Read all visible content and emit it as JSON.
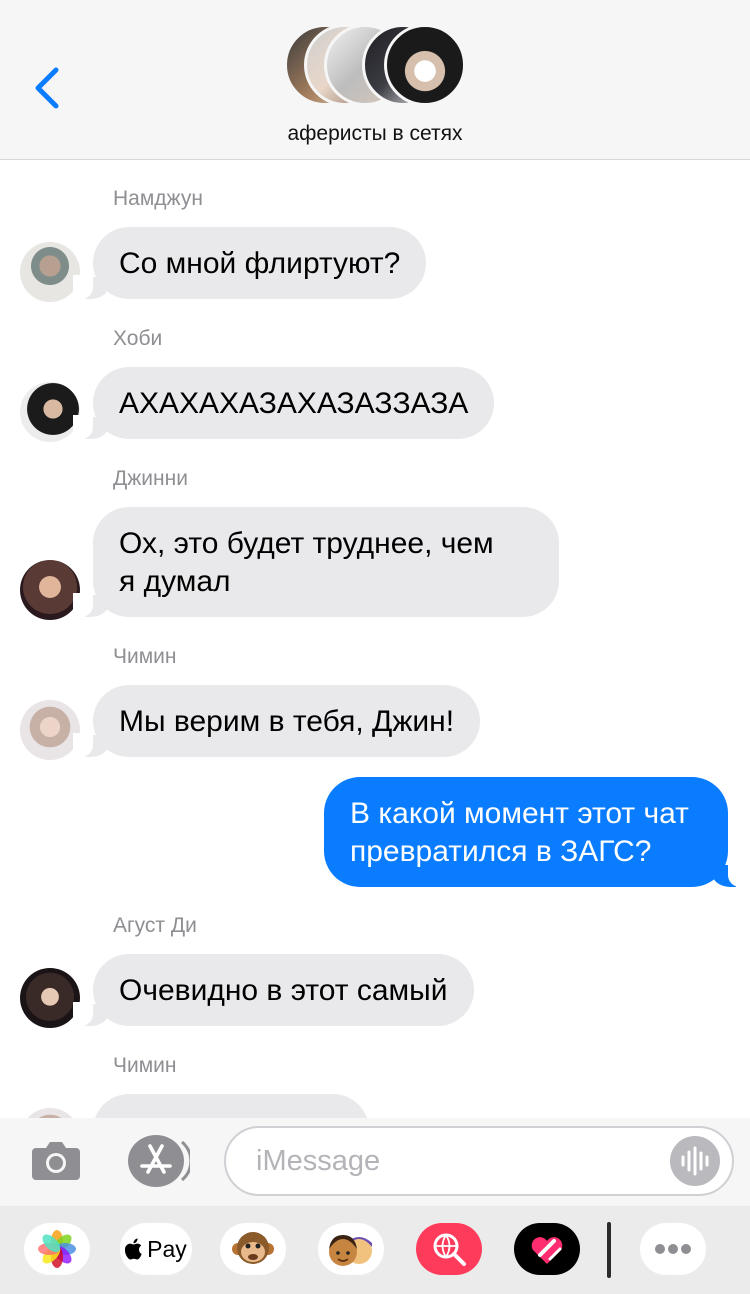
{
  "header": {
    "group_name": "аферисты в сетях",
    "accent": "#0a7cff"
  },
  "messages": [
    {
      "sender": "Намджун",
      "text": "Со мной флиртуют?",
      "direction": "incoming"
    },
    {
      "sender": "Хоби",
      "text": "АХАХАХАЗАХАЗАЗЗАЗА",
      "direction": "incoming"
    },
    {
      "sender": "Джинни",
      "text_line1": "Ох, это будет труднее, чем",
      "text_line2": "я думал",
      "direction": "incoming"
    },
    {
      "sender": "Чимин",
      "text": "Мы верим в тебя, Джин!",
      "direction": "incoming"
    },
    {
      "text_line1": "В какой момент этот чат",
      "text_line2": "превратился в ЗАГС?",
      "direction": "outgoing"
    },
    {
      "sender": "Агуст Ди",
      "text": "Очевидно в этот самый",
      "direction": "incoming"
    },
    {
      "sender": "Чимин",
      "direction": "incoming"
    }
  ],
  "composer": {
    "placeholder": "iMessage"
  },
  "drawer": {
    "apple_pay_label": "Pay",
    "apps": [
      "photos-icon",
      "apple-pay-icon",
      "monkey-animoji-icon",
      "memoji-icon",
      "image-search-icon",
      "digital-touch-icon",
      "more-icon"
    ]
  }
}
